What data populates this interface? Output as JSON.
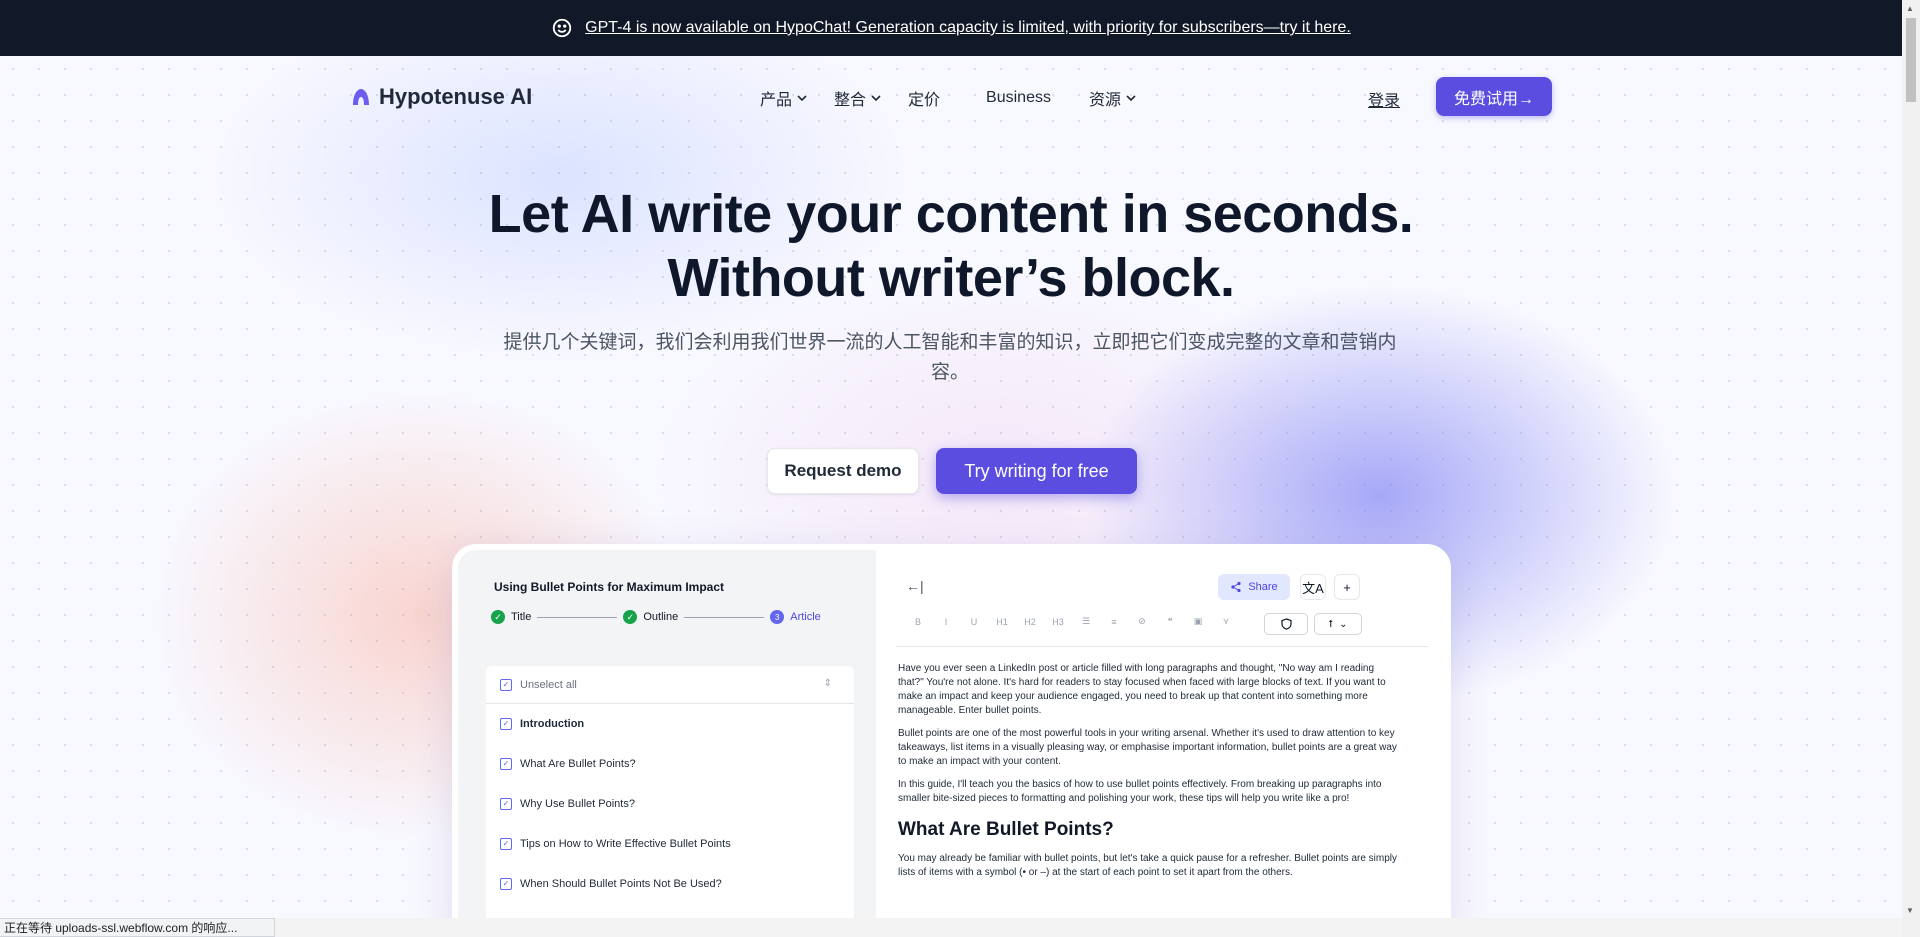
{
  "announcement": {
    "text": "GPT-4 is now available on HypoChat! Generation capacity is limited, with priority for subscribers—try it here."
  },
  "nav": {
    "logo": "Hypotenuse AI",
    "items": [
      {
        "label": "产品",
        "dropdown": true
      },
      {
        "label": "整合",
        "dropdown": true
      },
      {
        "label": "定价",
        "dropdown": false
      },
      {
        "label": "Business",
        "dropdown": false
      },
      {
        "label": "资源",
        "dropdown": true
      }
    ],
    "login": "登录",
    "cta": "免费试用→"
  },
  "hero": {
    "title_line1": "Let AI write your content in seconds.",
    "title_line2": "Without writer’s block.",
    "subtitle": "提供几个关键词，我们会利用我们世界一流的人工智能和丰富的知识，立即把它们变成完整的文章和营销内容。",
    "demo_button": "Request demo",
    "try_button": "Try writing for free"
  },
  "app": {
    "doc_title": "Using Bullet Points for Maximum Impact",
    "steps": [
      {
        "label": "Title",
        "state": "done"
      },
      {
        "label": "Outline",
        "state": "done"
      },
      {
        "label": "Article",
        "state": "active",
        "number": "3"
      }
    ],
    "outline": {
      "unselect_all": "Unselect all",
      "items": [
        {
          "label": "Introduction",
          "bold": true
        },
        {
          "label": "What Are Bullet Points?",
          "bold": false
        },
        {
          "label": "Why Use Bullet Points?",
          "bold": false
        },
        {
          "label": "Tips on How to Write Effective Bullet Points",
          "bold": false
        },
        {
          "label": "When Should Bullet Points Not Be Used?",
          "bold": false
        }
      ]
    },
    "editor": {
      "share_label": "Share",
      "toolbar": [
        "B",
        "I",
        "U",
        "H1",
        "H2",
        "H3",
        "☰",
        "≡",
        "⊘",
        "❝",
        "▣",
        "⋎"
      ],
      "paragraphs": [
        "Have you ever seen a LinkedIn post or article filled with long paragraphs and thought, \"No way am I reading that?\" You're not alone. It's hard for readers to stay focused when faced with large blocks of text. If you want to make an impact and keep your audience engaged, you need to break up that content into something more manageable. Enter bullet points.",
        "Bullet points are one of the most powerful tools in your writing arsenal. Whether it's used to draw attention to key takeaways, list items in a visually pleasing way, or emphasise important information, bullet points are a great way to make an impact with your content.",
        "In this guide, I'll teach you the basics of how to use bullet points effectively. From breaking up paragraphs into smaller bite-sized pieces to formatting and polishing your work, these tips will help you write like a pro!"
      ],
      "heading": "What Are Bullet Points?",
      "paragraph_after": "You may already be familiar with bullet points, but let's take a quick pause for a refresher. Bullet points are simply lists of items with a symbol (• or –) at the start of each point to set it apart from the others."
    }
  },
  "status_bar": {
    "text": "正在等待 uploads-ssl.webflow.com 的响应..."
  },
  "colors": {
    "accent": "#5b4de0",
    "announce_bg": "#111827",
    "success": "#16a34a"
  }
}
